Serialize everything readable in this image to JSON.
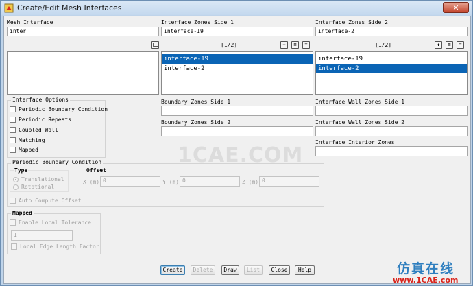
{
  "window": {
    "title": "Create/Edit Mesh Interfaces",
    "close_glyph": "✕"
  },
  "mesh_interface": {
    "label": "Mesh Interface",
    "value": "inter",
    "filter_icon": "filter-icon"
  },
  "side1": {
    "label": "Interface Zones Side 1",
    "value": "interface-19",
    "page": "[1/2]",
    "items": [
      {
        "label": "interface-19",
        "selected": true
      },
      {
        "label": "interface-2",
        "selected": false
      }
    ]
  },
  "side2": {
    "label": "Interface Zones Side 2",
    "value": "interface-2",
    "page": "[1/2]",
    "items": [
      {
        "label": "interface-19",
        "selected": false
      },
      {
        "label": "interface-2",
        "selected": true
      }
    ]
  },
  "interface_options": {
    "title": "Interface Options",
    "items": [
      "Periodic Boundary Condition",
      "Periodic Repeats",
      "Coupled Wall",
      "Matching",
      "Mapped"
    ]
  },
  "boundary_zones_side1": {
    "label": "Boundary Zones Side 1",
    "value": ""
  },
  "boundary_zones_side2": {
    "label": "Boundary Zones Side 2",
    "value": ""
  },
  "interface_wall_side1": {
    "label": "Interface Wall Zones Side 1",
    "value": ""
  },
  "interface_wall_side2": {
    "label": "Interface Wall Zones Side 2",
    "value": ""
  },
  "interface_interior": {
    "label": "Interface Interior Zones",
    "value": ""
  },
  "periodic": {
    "title": "Periodic Boundary Condition",
    "type_label": "Type",
    "type_options": [
      "Translational",
      "Rotational"
    ],
    "selected_type": "Translational",
    "offset_label": "Offset",
    "x_label": "X (m)",
    "x_value": "0",
    "y_label": "Y (m)",
    "y_value": "0",
    "z_label": "Z (m)",
    "z_value": "0",
    "auto_compute": "Auto Compute Offset"
  },
  "mapped": {
    "title": "Mapped",
    "enable_tol": "Enable Local Tolerance",
    "tol_value": "1",
    "edge_factor": "Local Edge Length Factor"
  },
  "buttons": {
    "create": "Create",
    "delete": "Delete",
    "draw": "Draw",
    "list": "List",
    "close": "Close",
    "help": "Help"
  },
  "watermark": "1CAE.COM",
  "brand": {
    "cn": "仿真在线",
    "url": "www.1CAE.com"
  },
  "colors": {
    "selection": "#0a64b5",
    "brand_blue": "#2f7fbf",
    "brand_red": "#d9251d"
  }
}
